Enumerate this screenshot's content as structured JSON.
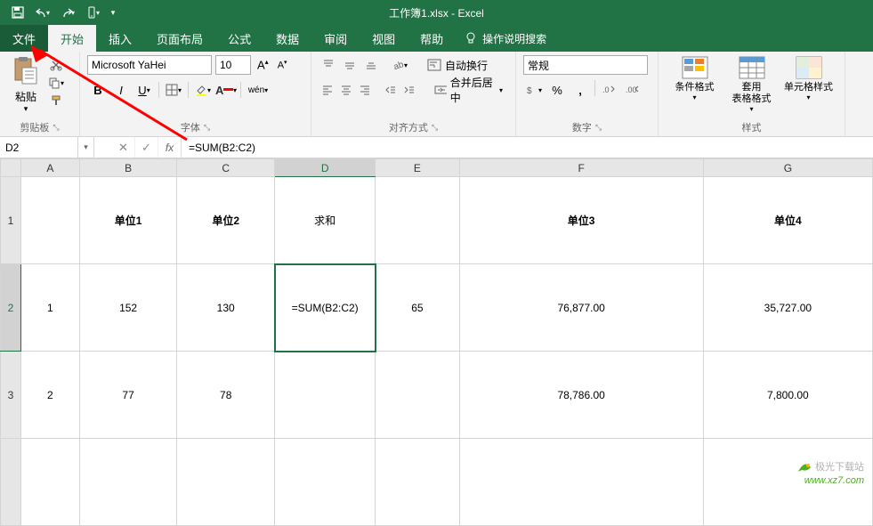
{
  "title": "工作簿1.xlsx - Excel",
  "tabs": {
    "file": "文件",
    "home": "开始",
    "insert": "插入",
    "layout": "页面布局",
    "formulas": "公式",
    "data": "数据",
    "review": "审阅",
    "view": "视图",
    "help": "帮助",
    "tell_me": "操作说明搜索"
  },
  "ribbon": {
    "clipboard": {
      "paste": "粘贴",
      "label": "剪贴板"
    },
    "font": {
      "name": "Microsoft YaHei",
      "size": "10",
      "wen": "wén",
      "label": "字体"
    },
    "alignment": {
      "wrap": "自动换行",
      "merge": "合并后居中",
      "label": "对齐方式"
    },
    "number": {
      "format": "常规",
      "label": "数字"
    },
    "styles": {
      "conditional": "条件格式",
      "table": "套用\n表格格式",
      "cell": "单元格样式",
      "label": "样式"
    }
  },
  "formula_bar": {
    "name_box": "D2",
    "formula": "=SUM(B2:C2)"
  },
  "columns": [
    "A",
    "B",
    "C",
    "D",
    "E",
    "F",
    "G"
  ],
  "rows": [
    "1",
    "2",
    "3"
  ],
  "cells": {
    "header": {
      "a": "",
      "b": "单位1",
      "c": "单位2",
      "d": "求和",
      "e": "",
      "f": "单位3",
      "g": "单位4"
    },
    "r2": {
      "a": "1",
      "b": "152",
      "c": "130",
      "d": "=SUM(B2:C2)",
      "e": "65",
      "f": "76,877.00",
      "g": "35,727.00"
    },
    "r3": {
      "a": "2",
      "b": "77",
      "c": "78",
      "d": "",
      "e": "",
      "f": "78,786.00",
      "g": "7,800.00"
    }
  },
  "chart_data": {
    "type": "table",
    "columns": [
      "",
      "单位1",
      "单位2",
      "求和",
      "",
      "单位3",
      "单位4"
    ],
    "rows": [
      [
        "1",
        152,
        130,
        "=SUM(B2:C2)",
        65,
        76877.0,
        35727.0
      ],
      [
        "2",
        77,
        78,
        null,
        null,
        78786.0,
        7800.0
      ]
    ]
  },
  "watermark": {
    "line1": "极光下载站",
    "line2": "www.xz7.com"
  }
}
